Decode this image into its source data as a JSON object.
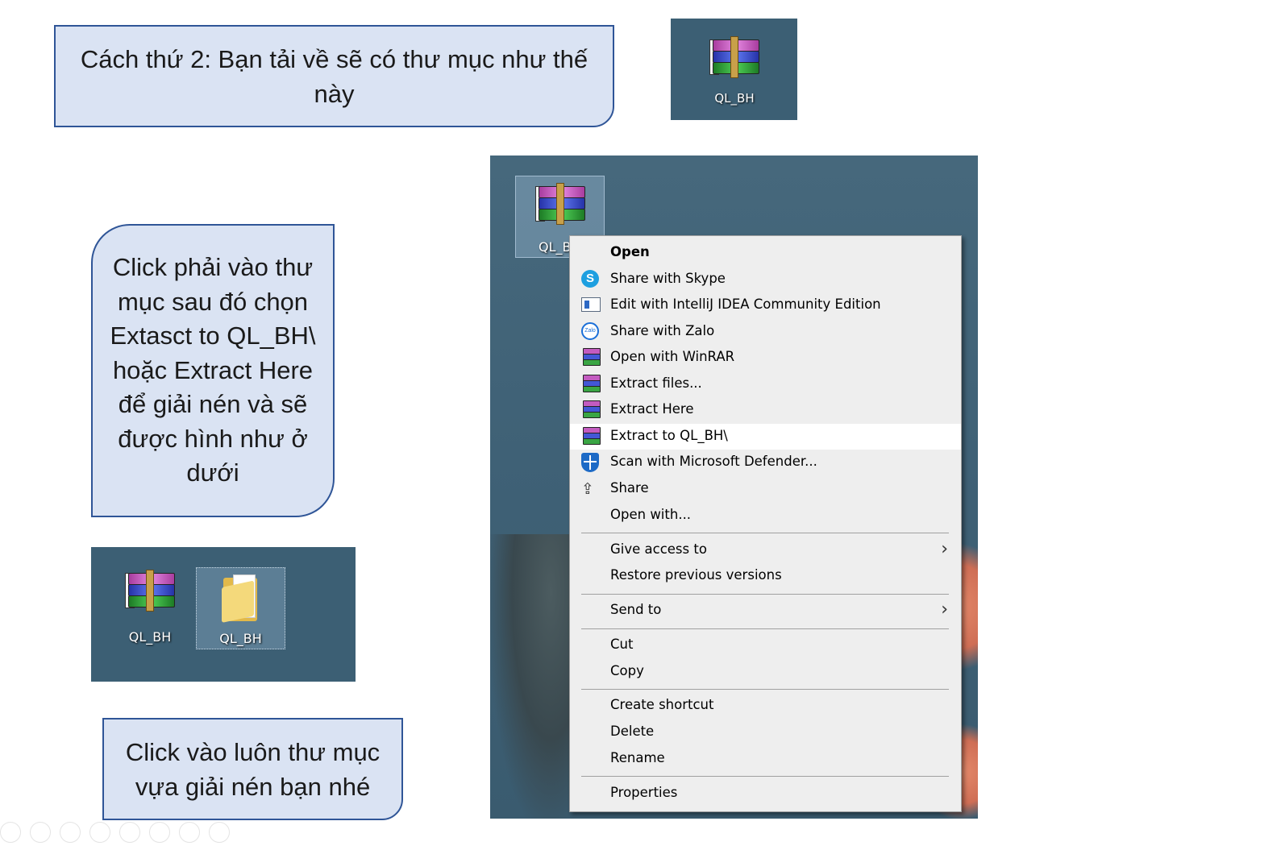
{
  "callouts": {
    "top": "Cách thứ 2: Bạn tải về sẽ có thư mục như thế này",
    "middle": "Click phải vào thư mục sau đó chọn Extasct to QL_BH\\ hoặc Extract Here để giải nén và sẽ được hình như ở dưới",
    "bottom": "Click vào luôn thư mục vựa giải nén bạn nhé"
  },
  "desktop_top": {
    "icon_label": "QL_BH",
    "icon": "winrar-archive-icon"
  },
  "desktop_bottom": {
    "icons": [
      {
        "label": "QL_BH",
        "icon": "winrar-archive-icon"
      },
      {
        "label": "QL_BH",
        "icon": "folder-icon"
      }
    ]
  },
  "desktop_main": {
    "icon_label": "QL_B",
    "icon": "winrar-archive-icon"
  },
  "context_menu": {
    "items": [
      {
        "label": "Open",
        "bold": true,
        "icon": ""
      },
      {
        "label": "Share with Skype",
        "icon": "skype-icon"
      },
      {
        "label": "Edit with IntelliJ IDEA Community Edition",
        "icon": "intellij-icon"
      },
      {
        "label": "Share with Zalo",
        "icon": "zalo-icon"
      },
      {
        "label": "Open with WinRAR",
        "icon": "winrar-icon"
      },
      {
        "label": "Extract files...",
        "icon": "winrar-icon"
      },
      {
        "label": "Extract Here",
        "icon": "winrar-icon"
      },
      {
        "label": "Extract to QL_BH\\",
        "icon": "winrar-icon",
        "highlighted": true
      },
      {
        "label": "Scan with Microsoft Defender...",
        "icon": "defender-icon"
      },
      {
        "label": "Share",
        "icon": "share-icon"
      },
      {
        "label": "Open with...",
        "icon": ""
      },
      {
        "label": "Give access to",
        "icon": "",
        "submenu": true
      },
      {
        "label": "Restore previous versions",
        "icon": ""
      },
      {
        "label": "Send to",
        "icon": "",
        "submenu": true
      },
      {
        "label": "Cut",
        "icon": ""
      },
      {
        "label": "Copy",
        "icon": ""
      },
      {
        "label": "Create shortcut",
        "icon": ""
      },
      {
        "label": "Delete",
        "icon": ""
      },
      {
        "label": "Rename",
        "icon": ""
      },
      {
        "label": "Properties",
        "icon": ""
      }
    ],
    "submenu_glyph": "›",
    "zalo_glyph": "Zalo",
    "skype_glyph": "S",
    "share_glyph": "⇪"
  },
  "colors": {
    "callout_fill": "#dae3f3",
    "callout_border": "#2f5597",
    "desktop_bg": "#3c5f74",
    "menu_bg": "#eeeeee",
    "menu_highlight": "#ffffff"
  }
}
